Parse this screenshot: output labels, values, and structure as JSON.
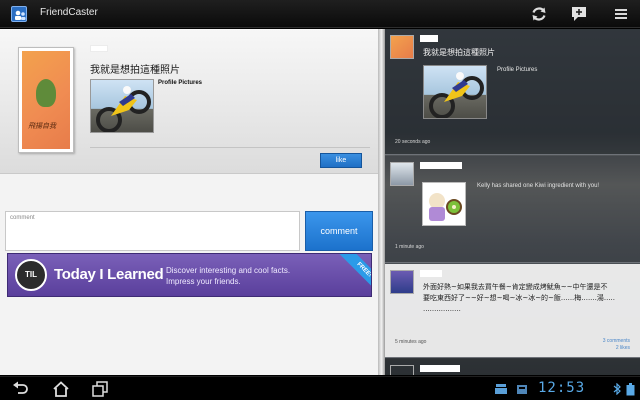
{
  "app": {
    "title": "FriendCaster"
  },
  "actionbar": {
    "icons": [
      "refresh-icon",
      "new-post-icon",
      "overflow-menu-icon"
    ]
  },
  "post": {
    "text": "我就是想拍這種照片",
    "album": "Profile Pictures",
    "avatar_signature": "飛揚自我",
    "like_label": "like"
  },
  "comment": {
    "placeholder": "comment",
    "button_label": "comment"
  },
  "ad": {
    "logo_text": "TIL",
    "title": "Today I Learned",
    "line1": "Discover interesting and cool facts.",
    "line2": "Impress your friends.",
    "ribbon": "FREE!"
  },
  "feed": {
    "items": [
      {
        "text": "我就是想拍這種照片",
        "album": "Profile Pictures",
        "time": "20 seconds ago"
      },
      {
        "text": "Kelly has shared one Kiwi ingredient with you!",
        "time": "1 minute ago"
      },
      {
        "text_line1": "外面好熱~如果我去買午餐~肯定變成烤魷魚~~中午還是不",
        "text_line2": "要吃東西好了~~好~想~喝~冰~冰~的~飯......梅.......湯.....",
        "text_line3": ".................",
        "time": "5 minutes ago",
        "comments": "3 comments",
        "likes": "2 likes"
      }
    ]
  },
  "status": {
    "clock": "12:53"
  },
  "colors": {
    "accent": "#1f6fc5",
    "clock": "#59a9e6",
    "ad_purple": "#6a4fae"
  }
}
